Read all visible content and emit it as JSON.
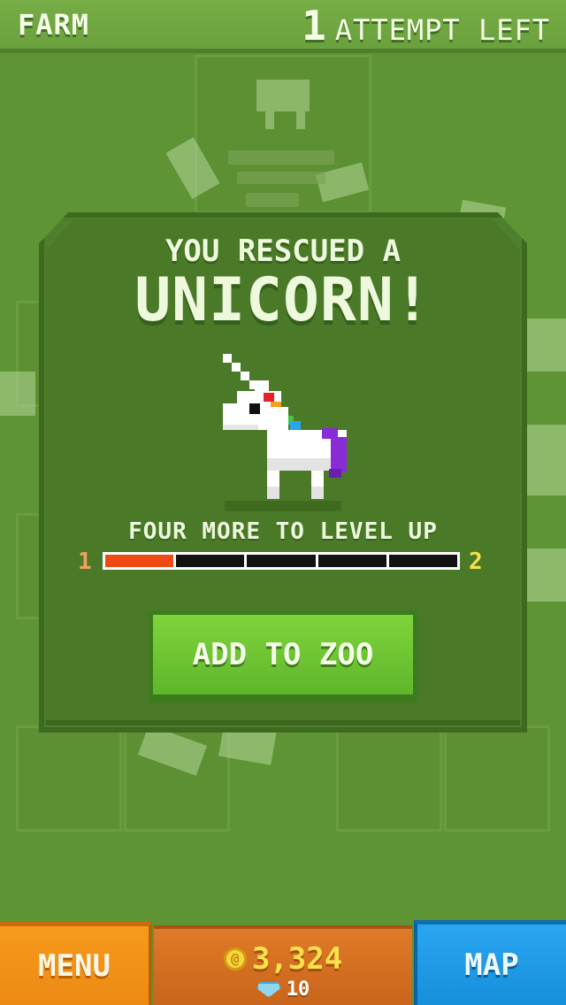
{
  "topbar": {
    "location": "FARM",
    "attempts_count": "1",
    "attempts_label": "ATTEMPT LEFT"
  },
  "dialog": {
    "subtitle": "YOU RESCUED A",
    "title": "UNICORN!",
    "levelup_text": "FOUR MORE TO LEVEL UP",
    "level_from": "1",
    "level_to": "2",
    "progress_segments_total": 5,
    "progress_segments_filled": 1,
    "add_button_label": "ADD TO ZOO"
  },
  "bottombar": {
    "menu_label": "MENU",
    "coins": "3,324",
    "gems": "10",
    "map_label": "MAP"
  },
  "icons": {
    "coin": "coin-icon",
    "gem": "gem-icon",
    "unicorn": "unicorn-sprite"
  },
  "colors": {
    "background": "#5f9434",
    "panel": "#4a7a28",
    "button_green": "#6ec832",
    "progress_fill": "#ee4b14",
    "menu_orange": "#f2921a",
    "currency_orange": "#d46f22",
    "map_blue": "#1e9be6",
    "coin_yellow": "#fde14a"
  }
}
